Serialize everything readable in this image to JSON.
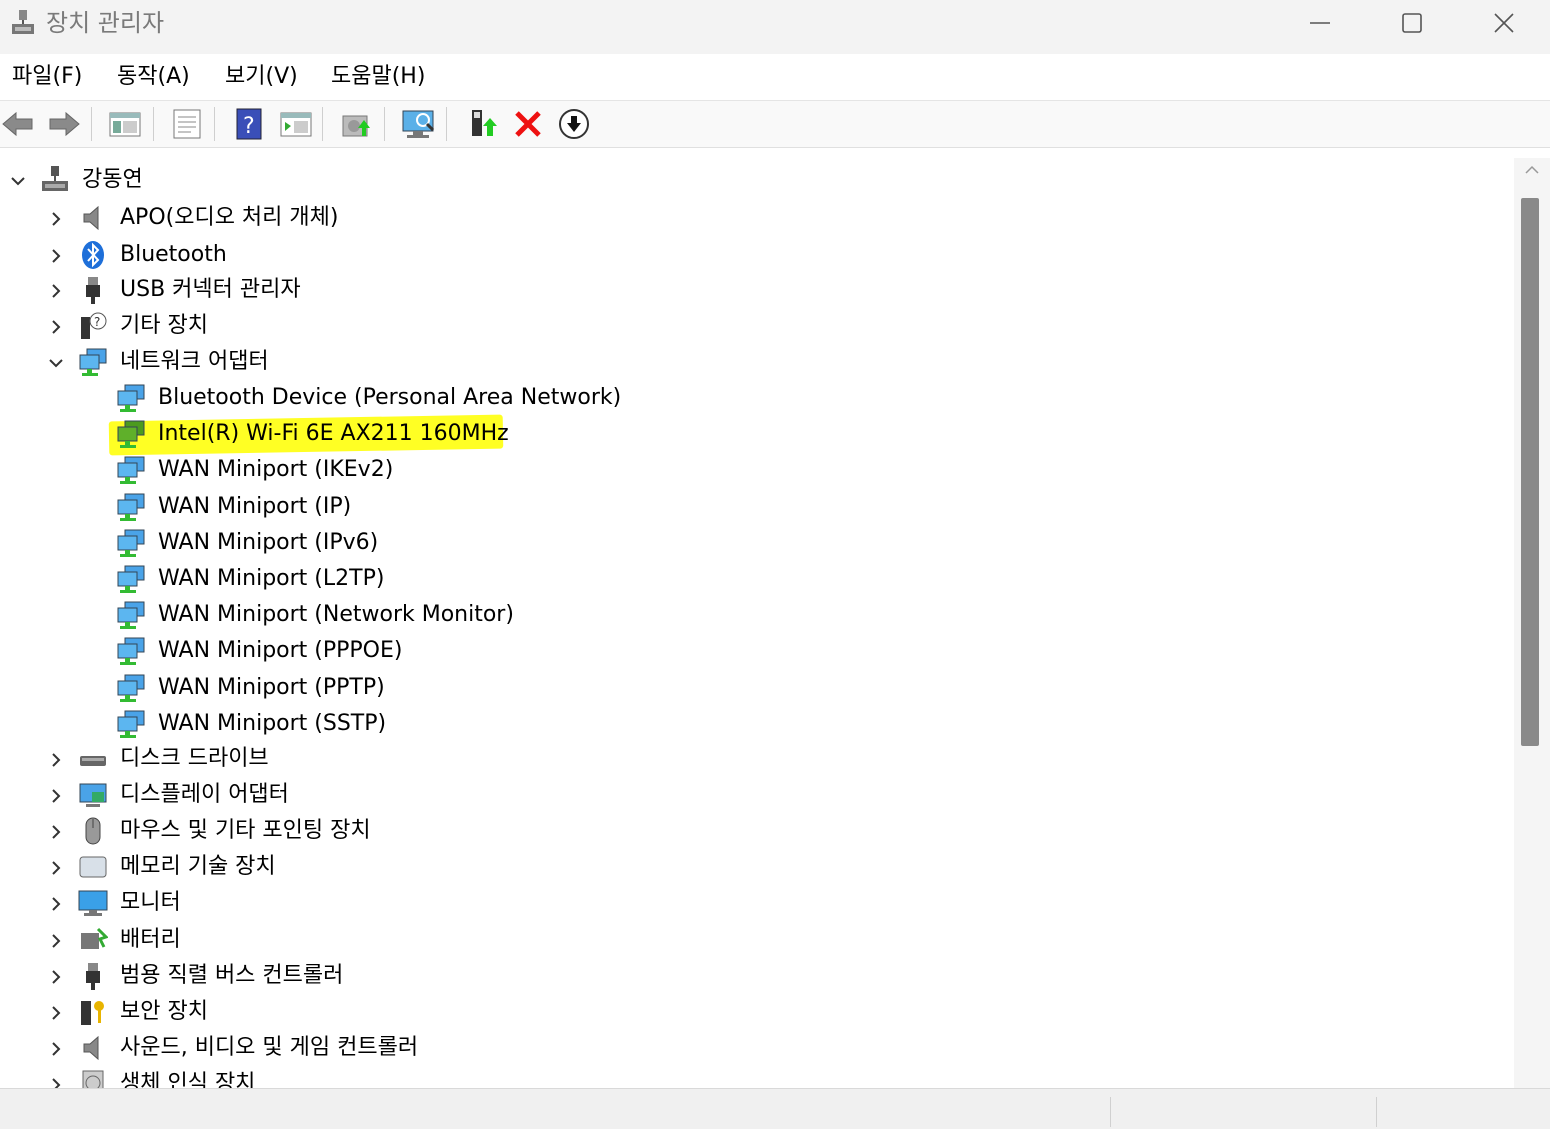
{
  "window": {
    "title": "장치 관리자"
  },
  "menu": [
    "파일(F)",
    "동작(A)",
    "보기(V)",
    "도움말(H)"
  ],
  "toolbar": [
    "back-icon",
    "forward-icon",
    "show-hide-tree-icon",
    "properties-icon",
    "help-icon",
    "view-icon",
    "update-driver-icon",
    "scan-hardware-icon",
    "enable-device-icon",
    "uninstall-device-icon",
    "disable-device-icon"
  ],
  "tree": {
    "root": "강동연",
    "categories": [
      "APO(오디오 처리 개체)",
      "Bluetooth",
      "USB 커넥터 관리자",
      "기타 장치",
      "네트워크 어댑터"
    ],
    "network_adapters": [
      "Bluetooth Device (Personal Area Network)",
      "Intel(R) Wi-Fi 6E AX211 160MHz",
      "WAN Miniport (IKEv2)",
      "WAN Miniport (IP)",
      "WAN Miniport (IPv6)",
      "WAN Miniport (L2TP)",
      "WAN Miniport (Network Monitor)",
      "WAN Miniport (PPPOE)",
      "WAN Miniport (PPTP)",
      "WAN Miniport (SSTP)"
    ],
    "categories_after": [
      "디스크 드라이브",
      "디스플레이 어댑터",
      "마우스 및 기타 포인팅 장치",
      "메모리 기술 장치",
      "모니터",
      "배터리",
      "범용 직렬 버스 컨트롤러",
      "보안 장치",
      "사운드, 비디오 및 게임 컨트롤러",
      "생체 인식 장치"
    ],
    "highlighted": "Intel(R) Wi-Fi 6E AX211 160MHz",
    "highlight_color": "#ffff24"
  }
}
